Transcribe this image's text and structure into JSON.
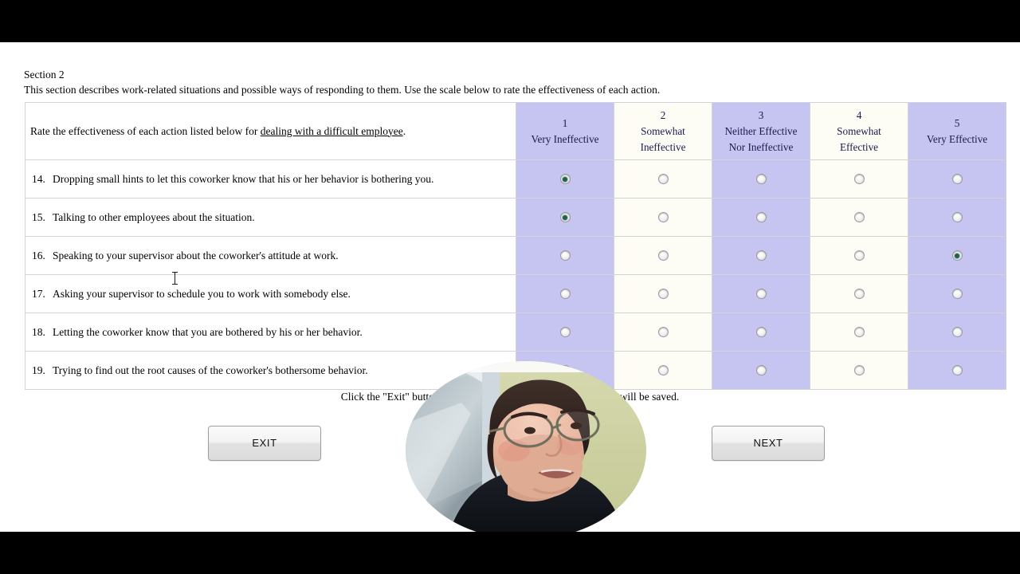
{
  "section": {
    "title": "Section 2",
    "description": "This section describes work-related situations and possible ways of responding to them.  Use the scale below to rate the effectiveness of each action."
  },
  "table": {
    "prompt_prefix": "Rate the effectiveness of each action listed below for ",
    "prompt_emphasis": "dealing with a difficult employee",
    "prompt_suffix": ".",
    "scale": [
      {
        "number": "1",
        "label": "Very Ineffective",
        "shaded": true
      },
      {
        "number": "2",
        "label": "Somewhat\nIneffective",
        "shaded": false
      },
      {
        "number": "3",
        "label": "Neither Effective\nNor Ineffective",
        "shaded": true
      },
      {
        "number": "4",
        "label": "Somewhat\nEffective",
        "shaded": false
      },
      {
        "number": "5",
        "label": "Very Effective",
        "shaded": true
      }
    ],
    "rows": [
      {
        "number": "14.",
        "text": "Dropping small hints to let this coworker know that his or her behavior is bothering you.",
        "selected": 1
      },
      {
        "number": "15.",
        "text": "Talking to other employees about the situation.",
        "selected": 1
      },
      {
        "number": "16.",
        "text": "Speaking to your supervisor about the coworker's attitude at work.",
        "selected": 5
      },
      {
        "number": "17.",
        "text": "Asking your supervisor to schedule you to work with somebody else.",
        "selected": 0
      },
      {
        "number": "18.",
        "text": "Letting the coworker know that you are bothered by his or her behavior.",
        "selected": 0
      },
      {
        "number": "19.",
        "text": "Trying to find out the root causes of the coworker's bothersome behavior.",
        "selected": 0
      }
    ]
  },
  "footer": {
    "note_visible_start": "Click the \"Exit\" button to co",
    "note_visible_end": "r progress will be saved.",
    "note_full": "Click the \"Exit\" button to continue at a later time.  Your progress will be saved."
  },
  "buttons": {
    "exit_label": "EXIT",
    "next_label": "NEXT"
  },
  "colors": {
    "scale_shade": "#c6c4f0",
    "scale_plain": "#fdfdf6",
    "radio_selected": "#1f5f54",
    "letterbox": "#000000",
    "page_background": "#ffffff"
  },
  "webcam": {
    "label": "webcam-self-view",
    "shape": "circle",
    "subject": "person with glasses and dark hair wearing a dark jacket",
    "background_left": "#b9c3c9",
    "background_right": "#cdd1a4"
  }
}
